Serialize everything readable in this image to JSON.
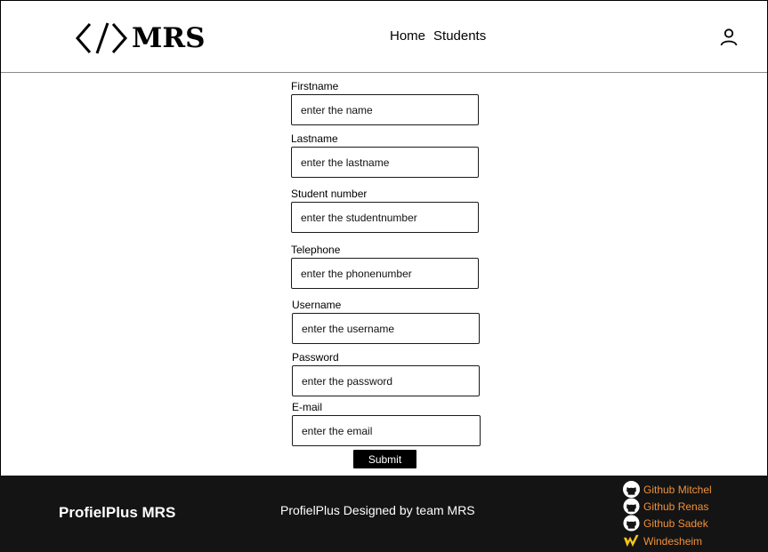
{
  "header": {
    "logo_text": "MRS",
    "nav": {
      "home": "Home",
      "students": "Students"
    }
  },
  "form": {
    "firstname": {
      "label": "Firstname",
      "placeholder": "enter the name"
    },
    "lastname": {
      "label": "Lastname",
      "placeholder": "enter the lastname"
    },
    "student_number": {
      "label": "Student number",
      "placeholder": "enter the studentnumber"
    },
    "telephone": {
      "label": "Telephone",
      "placeholder": "enter the phonenumber"
    },
    "username": {
      "label": "Username",
      "placeholder": "enter the username"
    },
    "password": {
      "label": "Password",
      "placeholder": "enter the password"
    },
    "email": {
      "label": "E-mail",
      "placeholder": "enter the email"
    },
    "submit_label": "Submit"
  },
  "footer": {
    "brand": "ProfielPlus MRS",
    "credit": "ProfielPlus Designed by team MRS",
    "links": [
      {
        "label": "Github Mitchel",
        "icon": "github-icon"
      },
      {
        "label": "Github Renas",
        "icon": "github-icon"
      },
      {
        "label": "Github Sadek",
        "icon": "github-icon"
      },
      {
        "label": "Windesheim",
        "icon": "windesheim-icon"
      }
    ]
  },
  "colors": {
    "footer_bg": "#141414",
    "link": "#f0913a",
    "windesheim": "#f5c518"
  }
}
